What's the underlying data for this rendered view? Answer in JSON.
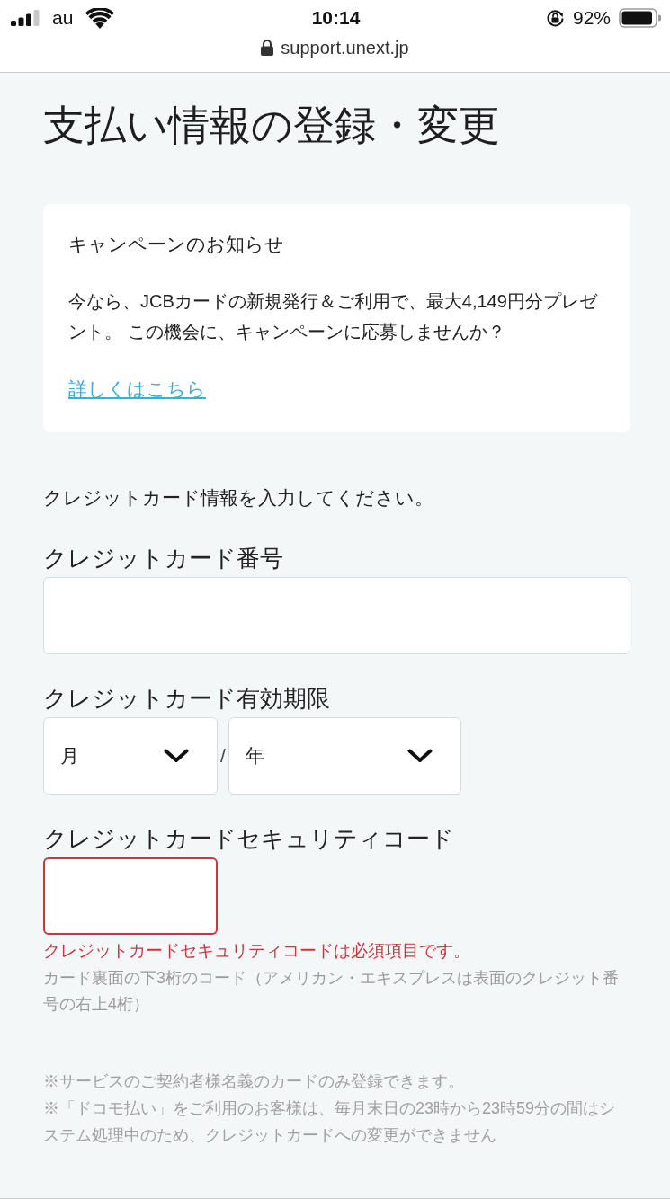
{
  "status_bar": {
    "carrier": "au",
    "time": "10:14",
    "battery": "92%"
  },
  "address_bar": {
    "url": "support.unext.jp"
  },
  "page_title": "支払い情報の登録・変更",
  "notice": {
    "heading": "キャンペーンのお知らせ",
    "body": "今なら、JCBカードの新規発行＆ご利用で、最大4,149円分プレゼント。 この機会に、キャンペーンに応募しませんか？",
    "link": "詳しくはこちら"
  },
  "form": {
    "instruction": "クレジットカード情報を入力してください。",
    "fields": [
      {
        "kind": "text",
        "label": "クレジットカード番号",
        "error": false
      },
      {
        "kind": "expiry",
        "label": "クレジットカード有効期限",
        "selects": [
          {
            "value": "月"
          },
          {
            "value": "年"
          }
        ],
        "separator": "/"
      },
      {
        "kind": "code",
        "label": "クレジットカードセキュリティコード",
        "error": true,
        "error_message": "クレジットカードセキュリティコードは必須項目です。",
        "hint": "カード裏面の下3桁のコード（アメリカン・エキスプレスは表面のクレジット番号の右上4桁）"
      }
    ]
  },
  "notes": [
    "※サービスのご契約者様名義のカードのみ登録できます。",
    "※「ドコモ払い」をご利用のお客様は、毎月末日の23時から23時59分の間はシステム処理中のため、クレジットカードへの変更ができません"
  ]
}
